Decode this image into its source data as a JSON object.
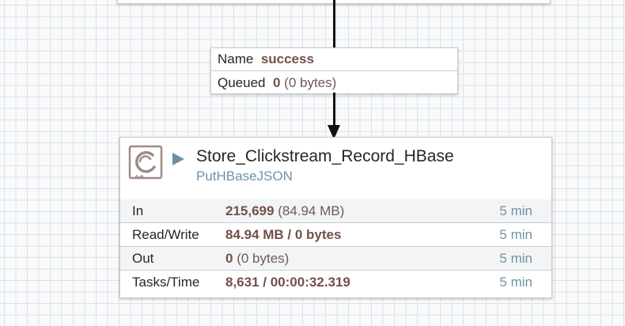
{
  "connection": {
    "name_label": "Name",
    "name_value": "success",
    "queued_label": "Queued",
    "queued_count": "0",
    "queued_size": "(0 bytes)"
  },
  "processor": {
    "name": "Store_Clickstream_Record_HBase",
    "type": "PutHBaseJSON",
    "stats": [
      {
        "label": "In",
        "value": "215,699",
        "value_extra": "(84.94 MB)",
        "time": "5 min"
      },
      {
        "label": "Read/Write",
        "value": "84.94 MB / 0 bytes",
        "value_extra": "",
        "time": "5 min"
      },
      {
        "label": "Out",
        "value": "0",
        "value_extra": "(0 bytes)",
        "time": "5 min"
      },
      {
        "label": "Tasks/Time",
        "value": "8,631 / 00:00:32.319",
        "value_extra": "",
        "time": "5 min"
      }
    ]
  },
  "colors": {
    "accent_value": "#73504a",
    "time_text": "#6f92a8",
    "connection_line": "#111111"
  },
  "icons": {
    "processor": "processor-icon",
    "run_status": "play-icon"
  }
}
